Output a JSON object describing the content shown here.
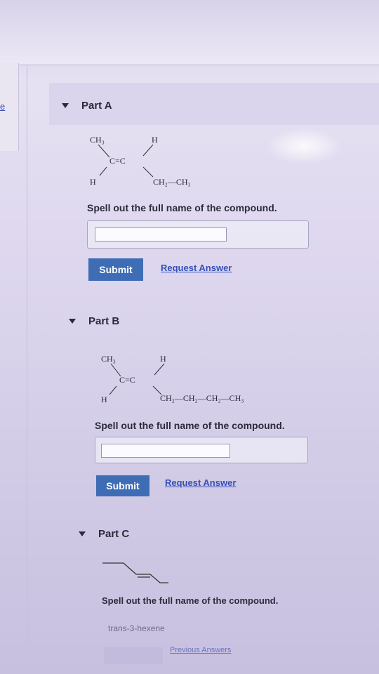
{
  "left_nav": {
    "link_text": "e"
  },
  "part_a": {
    "label": "Part A",
    "structure": {
      "ch3": "CH₃",
      "h_top": "H",
      "cc": "C=C",
      "h_left": "H",
      "chain": "CH₂—CH₃"
    },
    "prompt": "Spell out the full name of the compound.",
    "input_value": "",
    "submit_label": "Submit",
    "request_label": "Request Answer"
  },
  "part_b": {
    "label": "Part B",
    "structure": {
      "ch3": "CH₃",
      "h_top": "H",
      "cc": "C=C",
      "h_left": "H",
      "chain": "CH₂—CH₂—CH₂—CH₃"
    },
    "prompt": "Spell out the full name of the compound.",
    "input_value": "",
    "submit_label": "Submit",
    "request_label": "Request Answer"
  },
  "part_c": {
    "label": "Part C",
    "prompt": "Spell out the full name of the compound.",
    "answer": "trans-3-hexene",
    "previous_label": "Previous Answers"
  }
}
